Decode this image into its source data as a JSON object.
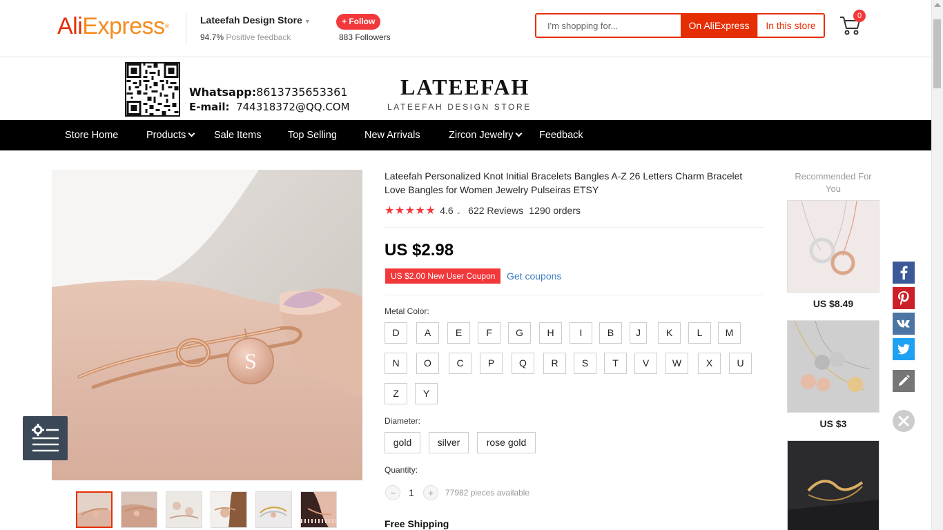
{
  "header": {
    "logo_ali": "Ali",
    "logo_express": "Express",
    "store_name": "Lateefah Design Store",
    "positive_pct": "94.7%",
    "positive_label": "Positive feedback",
    "follow_label": "+ Follow",
    "followers_count": "883",
    "followers_label": "Followers",
    "search_placeholder": "I'm shopping for...",
    "on_aliexpress": "On AliExpress",
    "in_this_store": "In this store",
    "cart_count": "0"
  },
  "banner": {
    "whatsapp_label": "Whatsapp:",
    "whatsapp_value": "8613735653361",
    "email_label": "E-mail:",
    "email_value": "744318372@QQ.COM",
    "brand": "LATEEFAH",
    "brand_sub": "LATEEFAH DESIGN STORE"
  },
  "nav": {
    "items": [
      {
        "label": "Store Home"
      },
      {
        "label": "Products"
      },
      {
        "label": "Sale Items"
      },
      {
        "label": "Top Selling"
      },
      {
        "label": "New Arrivals"
      },
      {
        "label": "Zircon Jewelry"
      },
      {
        "label": "Feedback"
      }
    ]
  },
  "product": {
    "title": "Lateefah Personalized Knot Initial Bracelets Bangles A-Z 26 Letters Charm Bracelet Love Bangles for Women Jewelry Pulseiras ETSY",
    "rating": "4.6",
    "rating_value": 4.6,
    "reviews": "622 Reviews",
    "orders": "1290 orders",
    "price": "US $2.98",
    "coupon": "US $2.00 New User Coupon",
    "get_coupons": "Get coupons",
    "metal_color_label": "Metal Color:",
    "letters": [
      "D",
      "A",
      "E",
      "F",
      "G",
      "H",
      "I",
      "B",
      "J",
      "K",
      "L",
      "M",
      "N",
      "O",
      "C",
      "P",
      "Q",
      "R",
      "S",
      "T",
      "V",
      "W",
      "X",
      "U",
      "Z",
      "Y"
    ],
    "diameter_label": "Diameter:",
    "diameters": [
      "gold",
      "silver",
      "rose gold"
    ],
    "quantity_label": "Quantity:",
    "qty_minus": "−",
    "qty_plus": "+",
    "quantity": "1",
    "available": "77982 pieces available",
    "free_shipping": "Free Shipping",
    "charm_letter": "S"
  },
  "recommended": {
    "title": "Recommended For You",
    "items": [
      {
        "price": "US $8.49"
      },
      {
        "price": "US $3"
      },
      {
        "price": ""
      }
    ]
  },
  "colors": {
    "accent": "#e62e04",
    "brand_orange": "#f68b1e",
    "star": "#f2383b",
    "link": "#3a7bbf",
    "nav_bg": "#000000",
    "facebook": "#3b5998",
    "pinterest": "#cb2027",
    "vk": "#4c75a3",
    "twitter": "#1da1f2",
    "edit": "#767676"
  },
  "icons": [
    "cart-icon",
    "qr-code",
    "chevron-down-icon",
    "star-icon",
    "settings-icon",
    "facebook-icon",
    "pinterest-icon",
    "vk-icon",
    "twitter-icon",
    "edit-icon",
    "close-icon"
  ]
}
